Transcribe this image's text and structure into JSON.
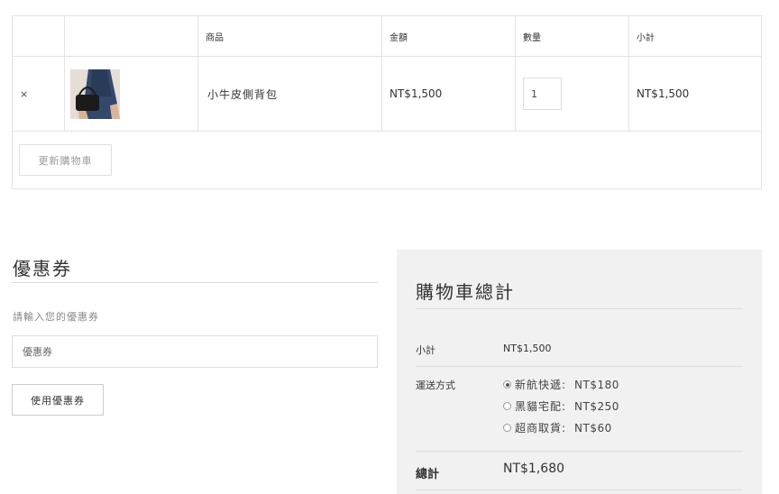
{
  "cart": {
    "headers": [
      "",
      "",
      "商品",
      "金額",
      "數量",
      "小計"
    ],
    "items": [
      {
        "remove": "×",
        "image": "shoulder-bag-thumbnail",
        "name": "小牛皮側背包",
        "price": "NT$1,500",
        "quantity": "1",
        "subtotal": "NT$1,500"
      }
    ],
    "update_button": "更新購物車"
  },
  "coupon": {
    "title": "優惠券",
    "hint": "請輸入您的優惠券",
    "placeholder": "優惠券",
    "apply_button": "使用優惠券"
  },
  "totals": {
    "title": "購物車總計",
    "subtotal_label": "小計",
    "subtotal_value": "NT$1,500",
    "shipping_label": "運送方式",
    "shipping_options": [
      {
        "name": "新航快遞:",
        "price": "NT$180",
        "selected": true
      },
      {
        "name": "黑貓宅配:",
        "price": "NT$250",
        "selected": false
      },
      {
        "name": "超商取貨:",
        "price": "NT$60",
        "selected": false
      }
    ],
    "total_label": "總計",
    "total_value": "NT$1,680"
  },
  "colors": {
    "panel_bg": "#f1f1f1",
    "border": "#e3e3e3"
  }
}
